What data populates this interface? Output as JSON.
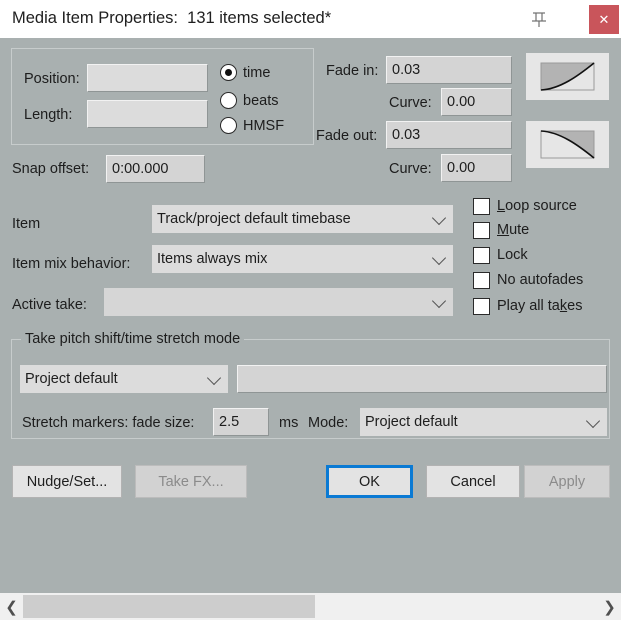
{
  "window": {
    "title": "Media Item Properties:  131 items selected*",
    "pin_icon": "pin-icon",
    "close_label": "✕"
  },
  "position_group": {
    "position_label": "Position:",
    "position_value": "",
    "length_label": "Length:",
    "length_value": "",
    "timebase_options": [
      {
        "label": "time",
        "selected": true
      },
      {
        "label": "beats",
        "selected": false
      },
      {
        "label": "HMSF",
        "selected": false
      }
    ]
  },
  "snap": {
    "label": "Snap offset:",
    "value": "0:00.000"
  },
  "fade": {
    "fade_in_label": "Fade in:",
    "fade_in_value": "0.03",
    "fade_in_curve_label": "Curve:",
    "fade_in_curve_value": "0.00",
    "fade_out_label": "Fade out:",
    "fade_out_value": "0.03",
    "fade_out_curve_label": "Curve:",
    "fade_out_curve_value": "0.00",
    "fade_in_shape_icon": "fade-in-curve-icon",
    "fade_out_shape_icon": "fade-out-curve-icon"
  },
  "selectors": {
    "item_label": "Item",
    "item_value": "Track/project default timebase",
    "mix_label": "Item mix behavior:",
    "mix_value": "Items always mix",
    "take_label": "Active take:",
    "take_value": ""
  },
  "checkboxes": [
    {
      "label": "Loop source",
      "checked": false
    },
    {
      "label": "Mute",
      "checked": false
    },
    {
      "label": "Lock",
      "checked": false
    },
    {
      "label": "No autofades",
      "checked": false
    },
    {
      "label": "Play all takes",
      "checked": false
    }
  ],
  "stretch_group": {
    "title": "Take pitch shift/time stretch mode",
    "mode_value": "Project default",
    "param_value": "",
    "markers_label": "Stretch markers: fade size:",
    "markers_value": "2.5",
    "units_label": "ms",
    "mode_label": "Mode:",
    "marker_mode_value": "Project default"
  },
  "buttons": {
    "nudge": "Nudge/Set...",
    "take_fx": "Take FX...",
    "ok": "OK",
    "cancel": "Cancel",
    "apply": "Apply"
  },
  "scrollbar": {
    "left_arrow": "❮",
    "right_arrow": "❯"
  },
  "colors": {
    "window_bg": "#a9b0b0",
    "close_red": "#c9555b",
    "focus_blue": "#0a7ad4",
    "field_bg": "#d4d4d4"
  }
}
